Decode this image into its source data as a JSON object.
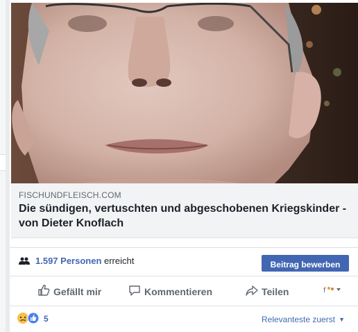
{
  "link_preview": {
    "domain": "FISCHUNDFLEISCH.COM",
    "headline": "Die sündigen, vertuschten und abgeschobenen Kriegskinder - von Dieter Knoflach"
  },
  "reach": {
    "count_label": "1.597 Personen",
    "suffix": " erreicht"
  },
  "promote_button": "Beitrag bewerben",
  "actions": {
    "like": "Gefällt mir",
    "comment": "Kommentieren",
    "share": "Teilen"
  },
  "reactions": {
    "count": "5"
  },
  "sort": {
    "label": "Relevanteste zuerst"
  },
  "icons": {
    "reach": "people-icon",
    "like": "thumbs-up-icon",
    "comment": "speech-bubble-icon",
    "share": "share-arrow-icon",
    "emoji_menu": "emoji-selector-icon",
    "sort_caret": "caret-down-icon",
    "reaction_sad": "sad-reaction-icon",
    "reaction_like": "like-reaction-icon"
  },
  "colors": {
    "accent": "#4267b2",
    "text_primary": "#1d2129",
    "text_secondary": "#606770"
  }
}
